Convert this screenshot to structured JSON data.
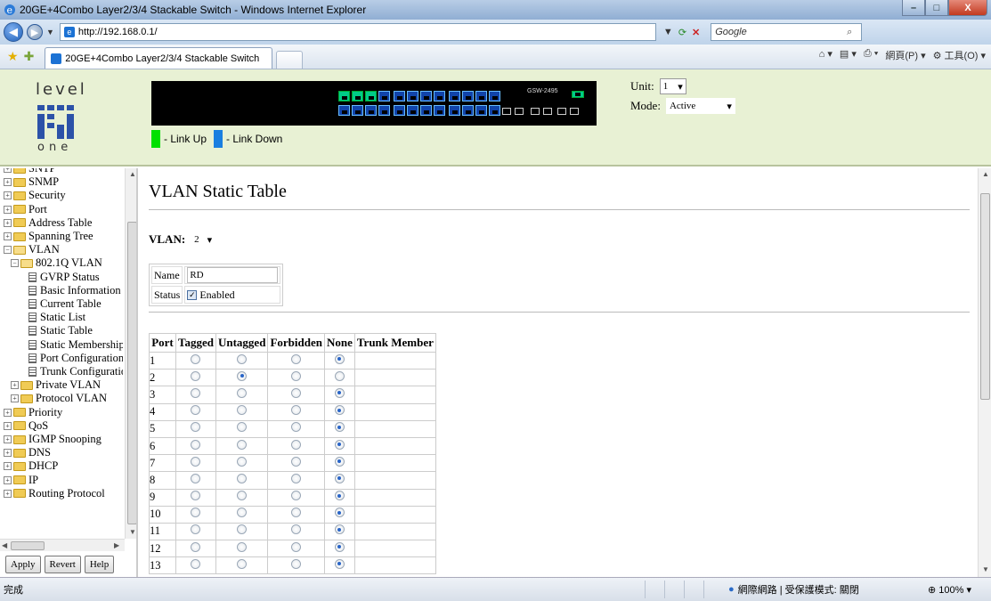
{
  "window": {
    "title": "20GE+4Combo Layer2/3/4 Stackable Switch - Windows Internet Explorer",
    "minimize": "–",
    "maximize": "□",
    "close": "X"
  },
  "browser": {
    "url": "http://192.168.0.1/",
    "search_placeholder": "Google",
    "tab_title": "20GE+4Combo Layer2/3/4 Stackable Switch",
    "page_menu": "網頁(P)",
    "tools_menu": "工具(O)"
  },
  "header": {
    "logo_top": "level",
    "logo_bottom": "one",
    "model": "GSW-2495",
    "legend_up": "- Link Up",
    "legend_down": "- Link Down",
    "unit_label": "Unit:",
    "unit_value": "1",
    "mode_label": "Mode:",
    "mode_value": "Active",
    "colors": {
      "link_up": "#00e000",
      "link_down": "#1a7fe0",
      "header_bg": "#e8f1d4"
    }
  },
  "tree": {
    "items": [
      {
        "label": "SNTP",
        "type": "folder"
      },
      {
        "label": "SNMP",
        "type": "folder"
      },
      {
        "label": "Security",
        "type": "folder"
      },
      {
        "label": "Port",
        "type": "folder"
      },
      {
        "label": "Address Table",
        "type": "folder"
      },
      {
        "label": "Spanning Tree",
        "type": "folder"
      },
      {
        "label": "VLAN",
        "type": "folder-open"
      },
      {
        "label": "802.1Q VLAN",
        "type": "folder-open"
      },
      {
        "label": "GVRP Status",
        "type": "doc"
      },
      {
        "label": "Basic Information",
        "type": "doc"
      },
      {
        "label": "Current Table",
        "type": "doc"
      },
      {
        "label": "Static List",
        "type": "doc"
      },
      {
        "label": "Static Table",
        "type": "doc"
      },
      {
        "label": "Static Membership",
        "type": "doc"
      },
      {
        "label": "Port Configuration",
        "type": "doc"
      },
      {
        "label": "Trunk Configuration",
        "type": "doc"
      },
      {
        "label": "Private VLAN",
        "type": "folder"
      },
      {
        "label": "Protocol VLAN",
        "type": "folder"
      },
      {
        "label": "Priority",
        "type": "folder"
      },
      {
        "label": "QoS",
        "type": "folder"
      },
      {
        "label": "IGMP Snooping",
        "type": "folder"
      },
      {
        "label": "DNS",
        "type": "folder"
      },
      {
        "label": "DHCP",
        "type": "folder"
      },
      {
        "label": "IP",
        "type": "folder"
      },
      {
        "label": "Routing Protocol",
        "type": "folder"
      }
    ],
    "buttons": {
      "apply": "Apply",
      "revert": "Revert",
      "help": "Help"
    }
  },
  "main": {
    "title": "VLAN Static Table",
    "vlan_label": "VLAN:",
    "vlan_value": "2",
    "name_label": "Name",
    "name_value": "RD",
    "status_label": "Status",
    "status_value": "Enabled",
    "table": {
      "headers": [
        "Port",
        "Tagged",
        "Untagged",
        "Forbidden",
        "None",
        "Trunk Member"
      ],
      "rows": [
        {
          "port": "1",
          "selected": "None"
        },
        {
          "port": "2",
          "selected": "Untagged"
        },
        {
          "port": "3",
          "selected": "None"
        },
        {
          "port": "4",
          "selected": "None"
        },
        {
          "port": "5",
          "selected": "None"
        },
        {
          "port": "6",
          "selected": "None"
        },
        {
          "port": "7",
          "selected": "None"
        },
        {
          "port": "8",
          "selected": "None"
        },
        {
          "port": "9",
          "selected": "None"
        },
        {
          "port": "10",
          "selected": "None"
        },
        {
          "port": "11",
          "selected": "None"
        },
        {
          "port": "12",
          "selected": "None"
        },
        {
          "port": "13",
          "selected": "None"
        }
      ]
    }
  },
  "statusbar": {
    "text": "完成",
    "zone": "網際網路 | 受保護模式: 關閉",
    "zoom": "100%"
  }
}
